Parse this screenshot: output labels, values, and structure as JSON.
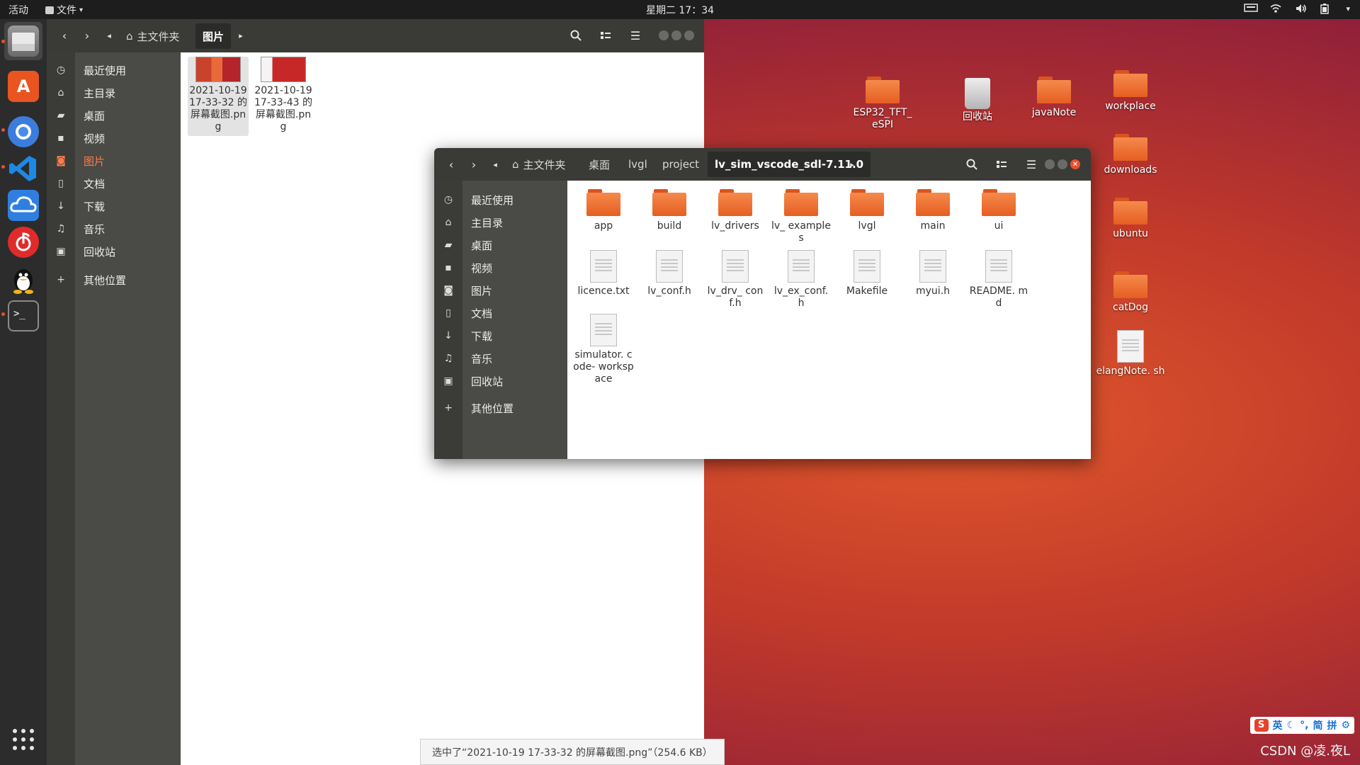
{
  "top_panel": {
    "activities": "活动",
    "app_menu": "文件",
    "clock": "星期二 17：34"
  },
  "dock": {
    "items": [
      {
        "icon": "files-icon",
        "active": true
      },
      {
        "icon": "software-center-icon"
      },
      {
        "icon": "chromium-icon"
      },
      {
        "icon": "vscode-icon"
      },
      {
        "icon": "cloud-icon"
      },
      {
        "icon": "netease-music-icon"
      },
      {
        "icon": "qq-icon"
      },
      {
        "icon": "terminal-icon"
      }
    ],
    "apps_grid": "show-applications-icon"
  },
  "back_window": {
    "breadcrumb": {
      "home": "主文件夹",
      "current": "图片"
    },
    "sidebar": [
      {
        "icon": "clock-icon",
        "label": "最近使用"
      },
      {
        "icon": "home-icon",
        "label": "主目录"
      },
      {
        "icon": "folder-icon",
        "label": "桌面"
      },
      {
        "icon": "video-icon",
        "label": "视频"
      },
      {
        "icon": "camera-icon",
        "label": "图片",
        "active": true
      },
      {
        "icon": "document-icon",
        "label": "文档"
      },
      {
        "icon": "download-icon",
        "label": "下载"
      },
      {
        "icon": "music-icon",
        "label": "音乐"
      },
      {
        "icon": "trash-icon",
        "label": "回收站"
      },
      {
        "icon": "plus-icon",
        "label": "其他位置"
      }
    ],
    "files": [
      {
        "name": "2021-10-19 17-33-32 的屏幕截图.png",
        "selected": true
      },
      {
        "name": "2021-10-19 17-33-43 的屏幕截图.png"
      }
    ],
    "status": "选中了“2021-10-19 17-33-32 的屏幕截图.png”（254.6 KB）"
  },
  "front_window": {
    "breadcrumb": [
      "主文件夹",
      "桌面",
      "lvgl",
      "project",
      "lv_sim_vscode_sdl-7.11.0"
    ],
    "sidebar": [
      {
        "icon": "clock-icon",
        "label": "最近使用"
      },
      {
        "icon": "home-icon",
        "label": "主目录"
      },
      {
        "icon": "folder-icon",
        "label": "桌面"
      },
      {
        "icon": "video-icon",
        "label": "视频"
      },
      {
        "icon": "camera-icon",
        "label": "图片"
      },
      {
        "icon": "document-icon",
        "label": "文档"
      },
      {
        "icon": "download-icon",
        "label": "下载"
      },
      {
        "icon": "music-icon",
        "label": "音乐"
      },
      {
        "icon": "trash-icon",
        "label": "回收站"
      },
      {
        "icon": "plus-icon",
        "label": "其他位置"
      }
    ],
    "files": [
      {
        "name": "app",
        "type": "folder"
      },
      {
        "name": "build",
        "type": "folder"
      },
      {
        "name": "lv_drivers",
        "type": "folder"
      },
      {
        "name": "lv_ examples",
        "type": "folder"
      },
      {
        "name": "lvgl",
        "type": "folder"
      },
      {
        "name": "main",
        "type": "folder"
      },
      {
        "name": "ui",
        "type": "folder"
      },
      {
        "name": "licence.txt",
        "type": "file"
      },
      {
        "name": "lv_conf.h",
        "type": "file"
      },
      {
        "name": "lv_drv_ conf.h",
        "type": "file"
      },
      {
        "name": "lv_ex_conf. h",
        "type": "file"
      },
      {
        "name": "Makefile",
        "type": "file"
      },
      {
        "name": "myui.h",
        "type": "file"
      },
      {
        "name": "README. md",
        "type": "file"
      },
      {
        "name": "simulator. code- workspace",
        "type": "file"
      }
    ]
  },
  "desktop": {
    "icons": [
      {
        "name": "ESP32_TFT_ eSPI",
        "type": "folder"
      },
      {
        "name": "回收站",
        "type": "trash"
      },
      {
        "name": "javaNote",
        "type": "folder"
      },
      {
        "name": "workplace",
        "type": "folder"
      },
      {
        "name": "downloads",
        "type": "folder"
      },
      {
        "name": "ubuntu",
        "type": "folder"
      },
      {
        "name": "catDog",
        "type": "folder"
      },
      {
        "name": "elangNote. sh",
        "type": "file"
      }
    ]
  },
  "ime": {
    "lang": "英",
    "simplified": "简",
    "pinyin": "拼"
  },
  "watermark": "CSDN @凌.夜L"
}
